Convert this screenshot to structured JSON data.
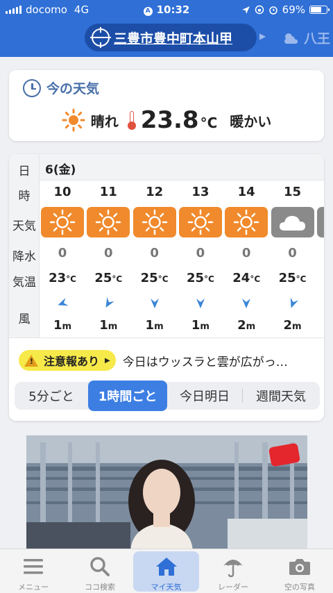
{
  "status_bar": {
    "carrier": "docomo",
    "network": "4G",
    "time": "10:32",
    "battery": "69%",
    "battery_level": 0.69
  },
  "location": {
    "name": "三豊市豊中町本山甲",
    "next": "八王"
  },
  "now": {
    "title": "今の天気",
    "condition": "晴れ",
    "temp": "23.8",
    "unit": "°C",
    "feel": "暖かい"
  },
  "hourly": {
    "labels": {
      "day": "日",
      "hour": "時",
      "weather": "天気",
      "rain": "降水",
      "temp": "気温",
      "wind": "風"
    },
    "day": "6(金)",
    "hours": [
      {
        "hour": "10",
        "weather": "sunny",
        "rain": "0",
        "temp": "23",
        "wind": "1",
        "wind_dir_deg": 70
      },
      {
        "hour": "11",
        "weather": "sunny",
        "rain": "0",
        "temp": "25",
        "wind": "1",
        "wind_dir_deg": 30
      },
      {
        "hour": "12",
        "weather": "sunny",
        "rain": "0",
        "temp": "25",
        "wind": "1",
        "wind_dir_deg": 0
      },
      {
        "hour": "13",
        "weather": "sunny",
        "rain": "0",
        "temp": "25",
        "wind": "1",
        "wind_dir_deg": 0
      },
      {
        "hour": "14",
        "weather": "sunny",
        "rain": "0",
        "temp": "24",
        "wind": "2",
        "wind_dir_deg": 0
      },
      {
        "hour": "15",
        "weather": "cloudy",
        "rain": "0",
        "temp": "25",
        "wind": "2",
        "wind_dir_deg": 20
      }
    ],
    "temp_unit": "°C",
    "wind_unit": "m"
  },
  "alert": {
    "badge": "注意報あり",
    "text": "今日はウッスラと雲が広がっ…"
  },
  "segments": [
    "5分ごと",
    "1時間ごと",
    "今日明日",
    "週間天気"
  ],
  "segments_active": 1,
  "tabs": [
    {
      "label": "メニュー",
      "icon": "menu-icon"
    },
    {
      "label": "ココ検索",
      "icon": "search-icon"
    },
    {
      "label": "マイ天気",
      "icon": "home-icon"
    },
    {
      "label": "レーダー",
      "icon": "umbrella-icon"
    },
    {
      "label": "空の写真",
      "icon": "camera-icon"
    }
  ],
  "tabs_active": 2,
  "colors": {
    "brand": "#2f6fd6",
    "sunny": "#f08a2c",
    "cloudy": "#8a8a8a",
    "alert": "#f6e94a",
    "active": "#3d7ee3"
  }
}
